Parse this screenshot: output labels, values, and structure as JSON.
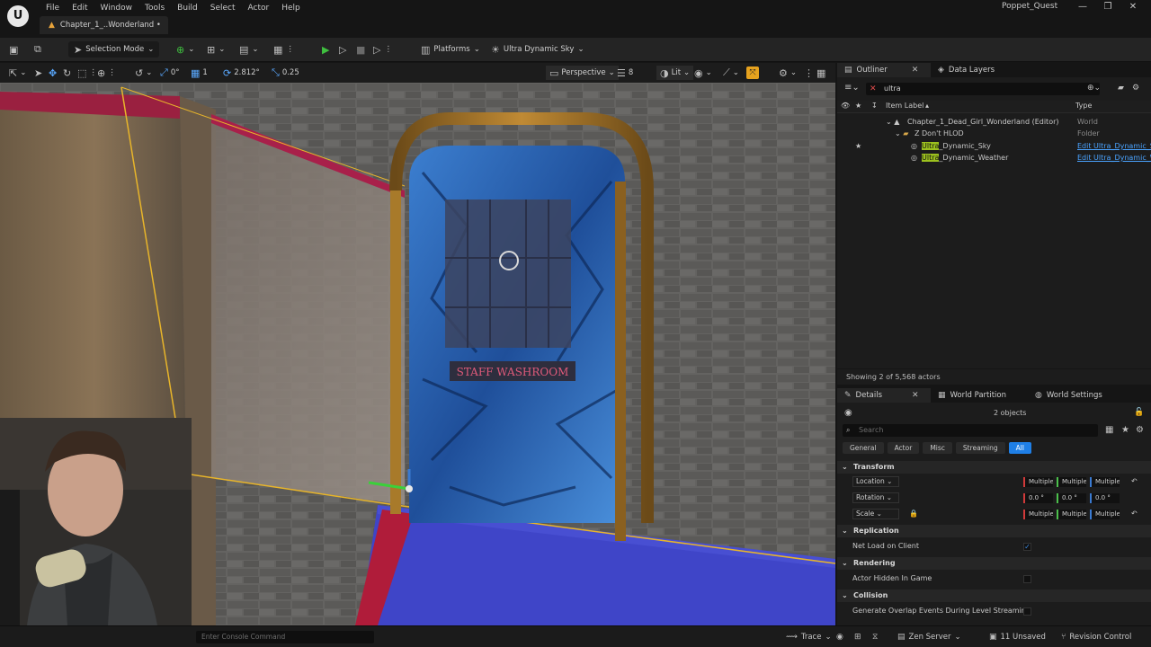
{
  "menu": {
    "items": [
      "File",
      "Edit",
      "Window",
      "Tools",
      "Build",
      "Select",
      "Actor",
      "Help"
    ]
  },
  "document_tab": {
    "label": "Chapter_1_..Wonderland •"
  },
  "project_name": "Poppet_Quest",
  "window_controls": {
    "minimize": "—",
    "restore": "❐",
    "close": "✕"
  },
  "toolbar": {
    "selection_mode": "Selection Mode",
    "platforms": "Platforms",
    "sky": "Ultra Dynamic Sky"
  },
  "viewport_toolbar": {
    "rotation_snap": "0°",
    "scale_snap": "1",
    "camera_speed": "2.812°",
    "grid_snap": "0.25",
    "view_mode": "Perspective",
    "fov": "8",
    "lit": "Lit"
  },
  "viewport": {
    "door_sign": "STAFF WASHROOM"
  },
  "colors": {
    "accent_orange": "#e6a21e",
    "highlight": "#9cc11e",
    "filter_active": "#1f7fe6",
    "link": "#4aa3ff"
  },
  "outliner": {
    "tab_label": "Outliner",
    "data_layers_tab": "Data Layers",
    "search_value": "ultra",
    "col_label": "Item Label",
    "col_type": "Type",
    "rows": [
      {
        "label": "Chapter_1_Dead_Girl_Wonderland (Editor)",
        "type": "World"
      },
      {
        "label": "Z Don't HLOD",
        "type": "Folder"
      },
      {
        "hl": "Ultra",
        "label": "_Dynamic_Sky",
        "type": "Edit Ultra_Dynamic_S"
      },
      {
        "hl": "Ultra",
        "label": "_Dynamic_Weather",
        "type": "Edit Ultra_Dynamic_W"
      }
    ],
    "footer": "Showing 2 of 5,568 actors"
  },
  "details": {
    "tab_label": "Details",
    "world_partition_tab": "World Partition",
    "world_settings_tab": "World Settings",
    "object_count": "2 objects",
    "search_placeholder": "Search",
    "filters": [
      "General",
      "Actor",
      "Misc",
      "Streaming",
      "All"
    ],
    "transform": {
      "header": "Transform",
      "location": {
        "label": "Location",
        "values": [
          "Multiple",
          "Multiple",
          "Multiple"
        ]
      },
      "rotation": {
        "label": "Rotation",
        "values": [
          "0.0 °",
          "0.0 °",
          "0.0 °"
        ]
      },
      "scale": {
        "label": "Scale",
        "values": [
          "Multiple",
          "Multiple",
          "Multiple"
        ]
      }
    },
    "replication": {
      "header": "Replication",
      "net_load": "Net Load on Client",
      "net_load_checked": true
    },
    "rendering": {
      "header": "Rendering",
      "hidden": "Actor Hidden In Game",
      "hidden_checked": false
    },
    "collision": {
      "header": "Collision",
      "overlap": "Generate Overlap Events During Level Streaming",
      "overlap_checked": false
    }
  },
  "status_bar": {
    "console_placeholder": "Enter Console Command",
    "trace": "Trace",
    "zen": "Zen Server",
    "unsaved": "11 Unsaved",
    "revision": "Revision Control"
  }
}
